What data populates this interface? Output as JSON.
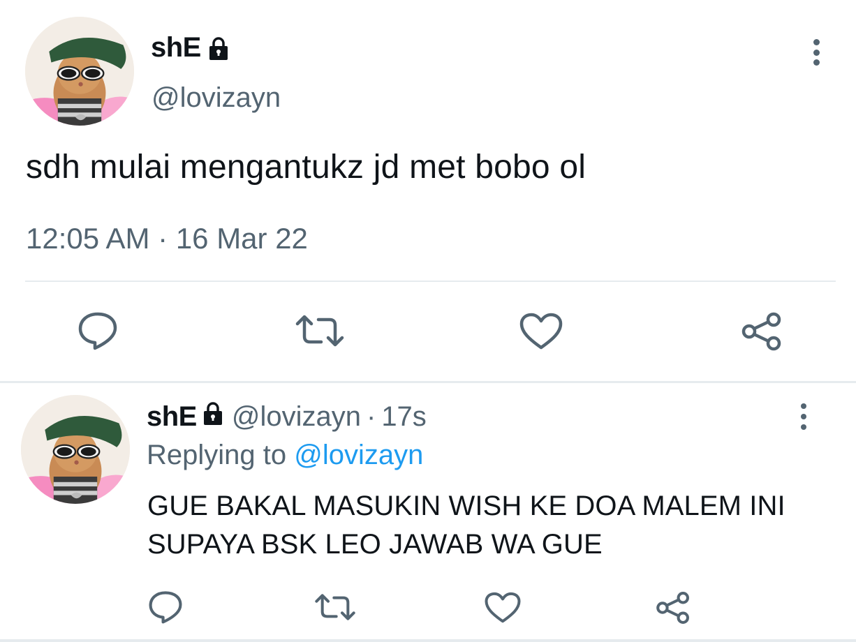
{
  "main_tweet": {
    "display_name": "shE",
    "handle": "@lovizayn",
    "text": "sdh mulai mengantukz jd met bobo ol",
    "time": "12:05 AM",
    "separator": "·",
    "date": "16 Mar 22",
    "icons": {
      "lock": "lock-icon",
      "more": "more-vertical-icon",
      "reply": "reply-icon",
      "retweet": "retweet-icon",
      "like": "heart-icon",
      "share": "share-icon"
    }
  },
  "reply_tweet": {
    "display_name": "shE",
    "handle": "@lovizayn",
    "separator": "·",
    "age": "17s",
    "replying_to_label": "Replying to",
    "replying_to_handle": "@lovizayn",
    "text": "GUE BAKAL MASUKIN WISH KE DOA MALEM INI SUPAYA BSK LEO JAWAB WA GUE"
  },
  "colors": {
    "text": "#0f1419",
    "muted": "#536471",
    "link": "#1d9bf0",
    "divider": "#e6ebee",
    "background": "#ffffff"
  }
}
